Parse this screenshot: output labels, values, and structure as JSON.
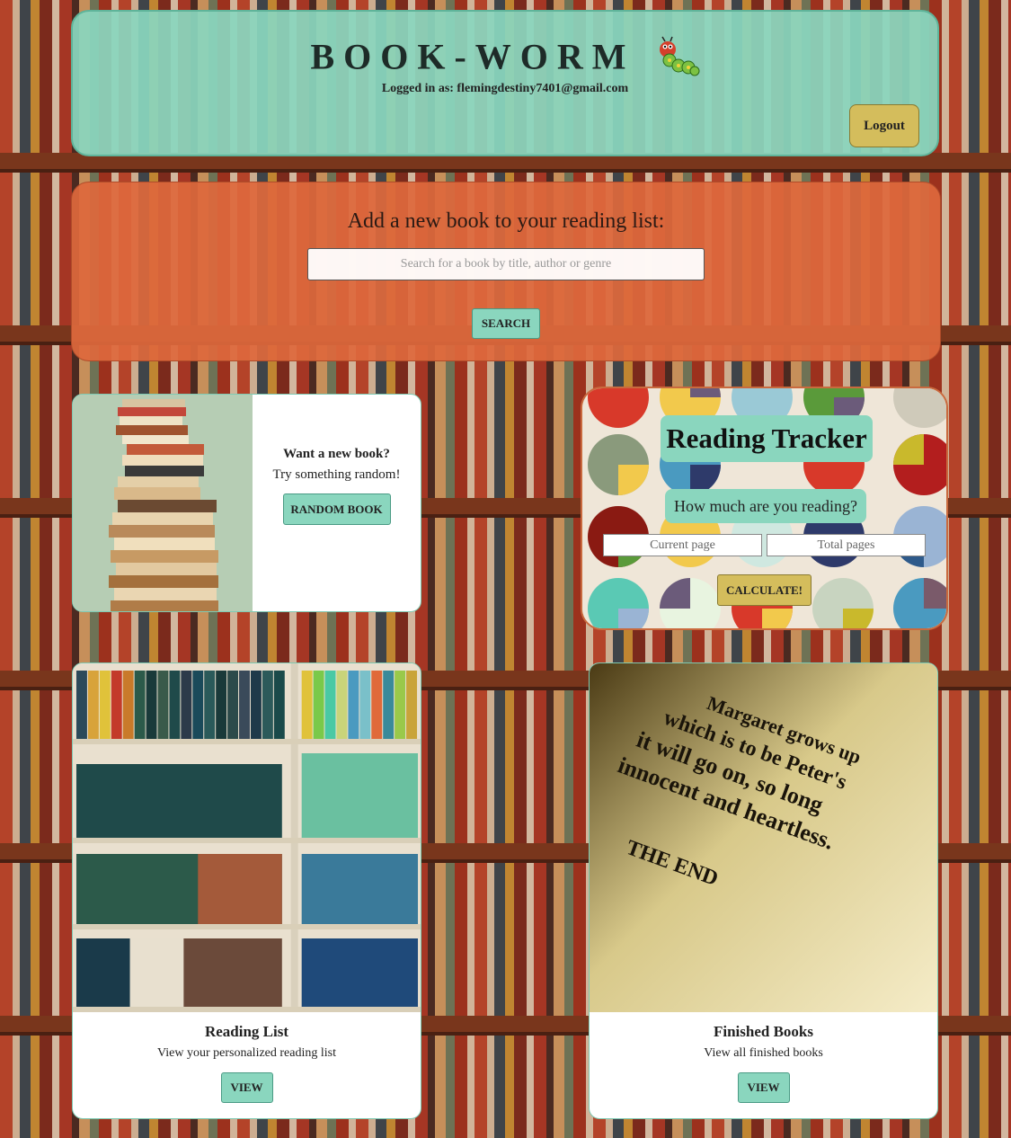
{
  "header": {
    "title": "BOOK-WORM",
    "logged_in_text": "Logged in as: flemingdestiny7401@gmail.com",
    "logout_label": "Logout"
  },
  "search": {
    "heading": "Add a new book to your reading list:",
    "placeholder": "Search for a book by title, author or genre",
    "button_label": "SEARCH"
  },
  "random": {
    "title": "Want a new book?",
    "subtitle": "Try something random!",
    "button_label": "RANDOM BOOK"
  },
  "tracker": {
    "title": "Reading Tracker",
    "question": "How much are you reading?",
    "current_placeholder": "Current page",
    "total_placeholder": "Total pages",
    "button_label": "CALCULATE!"
  },
  "reading_list": {
    "title": "Reading List",
    "description": "View your personalized reading list",
    "button_label": "VIEW"
  },
  "finished": {
    "title": "Finished Books",
    "description": "View all finished books",
    "button_label": "VIEW",
    "image_text": [
      "Margaret grows up",
      "which is to be Peter's",
      "it will go on, so long",
      "innocent and heartless.",
      "THE END"
    ]
  },
  "colors": {
    "mint": "#8ad6be",
    "orange": "#de683c",
    "gold": "#d4bd5c"
  }
}
